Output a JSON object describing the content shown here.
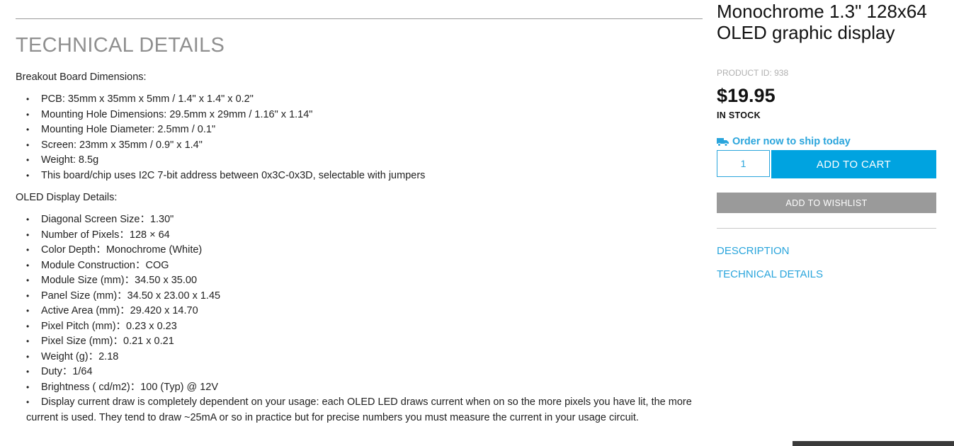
{
  "details": {
    "section_title": "TECHNICAL DETAILS",
    "breakout_label": "Breakout Board Dimensions:",
    "breakout_items": [
      "PCB: 35mm x 35mm x 5mm / 1.4\" x 1.4\" x 0.2\"",
      "Mounting Hole Dimensions: 29.5mm x 29mm / 1.16\" x 1.14\"",
      "Mounting Hole Diameter: 2.5mm / 0.1\"",
      "Screen: 23mm x 35mm / 0.9\" x 1.4\"",
      "Weight: 8.5g",
      "This board/chip uses I2C 7-bit address between 0x3C-0x3D, selectable with jumpers"
    ],
    "oled_label": "OLED Display Details:",
    "oled_items": [
      "Diagonal Screen Size：1.30\"",
      "Number of Pixels：128 × 64",
      "Color Depth：Monochrome (White)",
      "Module Construction：COG",
      "Module Size (mm)：34.50 x 35.00",
      "Panel Size (mm)：34.50 x 23.00 x 1.45",
      "Active Area (mm)：29.420 x 14.70",
      "Pixel Pitch (mm)：0.23 x 0.23",
      "Pixel Size (mm)：0.21 x 0.21",
      "Weight (g)：2.18",
      "Duty：1/64",
      "Brightness ( cd/m2)：100 (Typ) @ 12V"
    ],
    "current_note": "Display current draw is completely dependent on your usage: each OLED LED draws current when on so the more pixels you have lit, the more current is used. They tend to draw ~25mA or so in practice but for precise numbers you must measure the current in your usage circuit."
  },
  "product": {
    "title": "Monochrome 1.3\" 128x64 OLED graphic display",
    "product_id": "PRODUCT ID: 938",
    "price": "$19.95",
    "stock": "IN STOCK",
    "ship_text": "Order now to ship today",
    "ship_icon": "truck-icon",
    "quantity": "1",
    "add_to_cart": "ADD TO CART",
    "add_to_wishlist": "ADD TO WISHLIST",
    "links": [
      "DESCRIPTION",
      "TECHNICAL DETAILS"
    ]
  },
  "colors": {
    "accent": "#00a3e0",
    "link": "#2aa5dc",
    "muted_button": "#9a9a9a",
    "heading_gray": "#8f8f8f"
  }
}
